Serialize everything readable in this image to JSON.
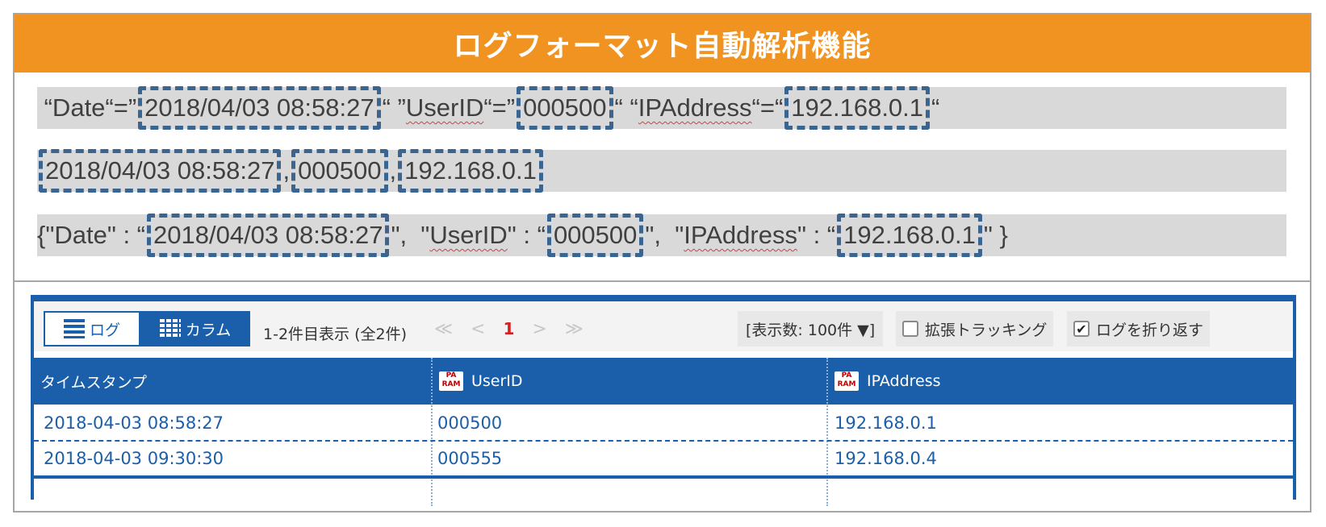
{
  "banner": {
    "title": "ログフォーマット自動解析機能"
  },
  "examples": {
    "row1": {
      "a": " “Date“=”",
      "date": "2018/04/03 08:58:27",
      "b": "“ ”",
      "user_key": "UserID",
      "c": "“=”",
      "user": "000500",
      "d": "“ “",
      "ip_key": "IPAddress",
      "e": "“=“",
      "ip": "192.168.0.1",
      "f": "“"
    },
    "row2": {
      "date": " 2018/04/03 08:58:27",
      "sep1": ",",
      "user": "000500",
      "sep2": ",",
      "ip": "192.168.0.1"
    },
    "row3": {
      "a": "{\"Date\" : “",
      "date": "2018/04/03 08:58:27",
      "b": "\",  \"",
      "user_key": "UserID",
      "c": "\" : “",
      "user": "000500",
      "d": "\",  \"",
      "ip_key": "IPAddress",
      "e": "\" : “",
      "ip": " 192.168.0.1",
      "f": "\" }"
    }
  },
  "viewer": {
    "tabs": {
      "log": "ログ",
      "column": "カラム"
    },
    "count": "1-2件目表示 (全2件)",
    "pager": {
      "first": "≪",
      "prev": "<",
      "current": "1",
      "next": ">",
      "last": "≫"
    },
    "display_count": "[表示数: 100件 ▼]",
    "extended_tracking": "拡張トラッキング",
    "wrap_log": "ログを折り返す",
    "wrap_checked": "✔",
    "param_icon": "PA RAM",
    "columns": [
      "タイムスタンプ",
      "UserID",
      "IPAddress"
    ],
    "rows": [
      [
        "2018-04-03 08:58:27",
        "000500",
        "192.168.0.1"
      ],
      [
        "2018-04-03 09:30:30",
        "000555",
        "192.168.0.4"
      ]
    ]
  },
  "colors": {
    "banner": "#f19320",
    "accent": "#1b5faa",
    "highlight": "#3a6591",
    "row_bg": "#d9d9d9"
  }
}
